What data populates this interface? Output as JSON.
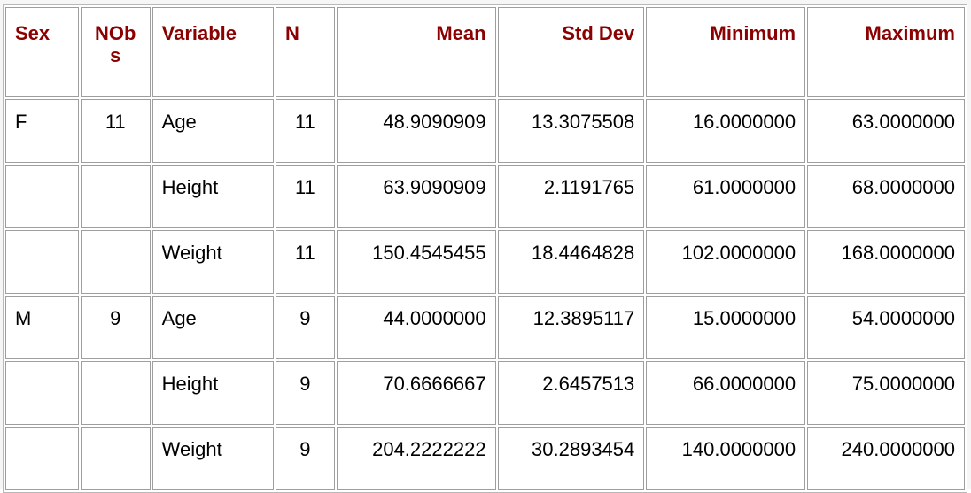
{
  "table": {
    "headers": [
      "Sex",
      "NObs",
      "Variable",
      "N",
      "Mean",
      "Std Dev",
      "Minimum",
      "Maximum"
    ],
    "rows": [
      [
        "F",
        "11",
        "Age",
        "11",
        "48.9090909",
        "13.3075508",
        "16.0000000",
        "63.0000000"
      ],
      [
        "",
        "",
        "Height",
        "11",
        "63.9090909",
        "2.1191765",
        "61.0000000",
        "68.0000000"
      ],
      [
        "",
        "",
        "Weight",
        "11",
        "150.4545455",
        "18.4464828",
        "102.0000000",
        "168.0000000"
      ],
      [
        "M",
        "9",
        "Age",
        "9",
        "44.0000000",
        "12.3895117",
        "15.0000000",
        "54.0000000"
      ],
      [
        "",
        "",
        "Height",
        "9",
        "70.6666667",
        "2.6457513",
        "66.0000000",
        "75.0000000"
      ],
      [
        "",
        "",
        "Weight",
        "9",
        "204.2222222",
        "30.2893454",
        "140.0000000",
        "240.0000000"
      ]
    ]
  }
}
